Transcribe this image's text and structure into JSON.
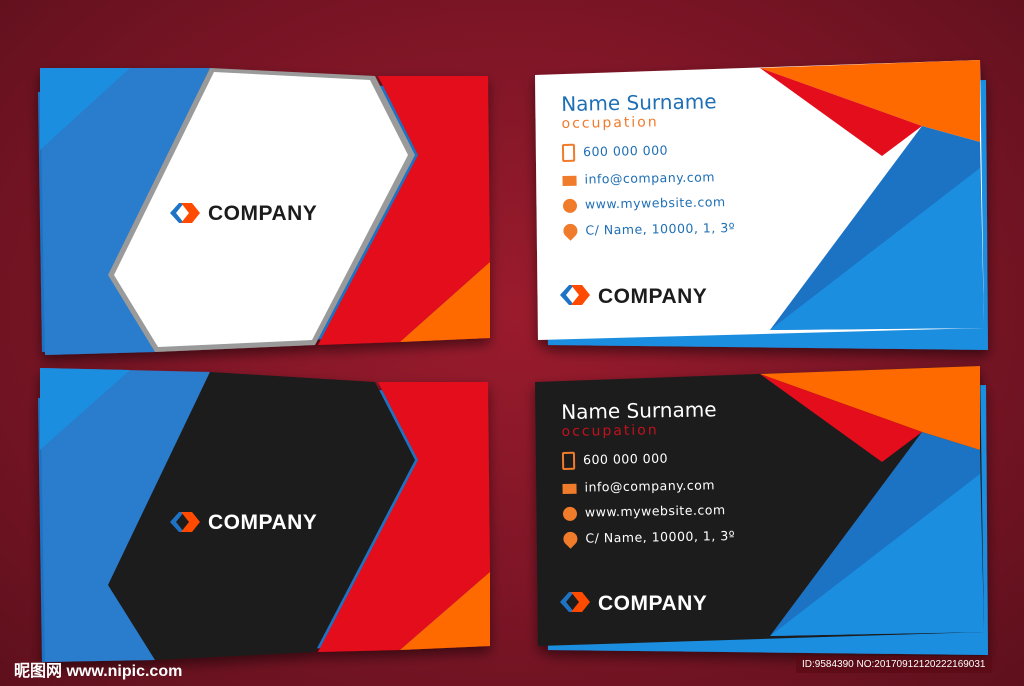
{
  "cards": {
    "front_white": {
      "company": "COMPANY"
    },
    "front_black": {
      "company": "COMPANY"
    },
    "back_white": {
      "name": "Name Surname",
      "occupation": "occupation",
      "phone": "600 000 000",
      "email": "info@company.com",
      "website": "www.mywebsite.com",
      "address": "C/ Name, 10000, 1, 3º",
      "company": "COMPANY"
    },
    "back_black": {
      "name": "Name Surname",
      "occupation": "occupation",
      "phone": "600 000 000",
      "email": "info@company.com",
      "website": "www.mywebsite.com",
      "address": "C/ Name, 10000, 1, 3º",
      "company": "COMPANY"
    }
  },
  "watermark": {
    "site": "昵图网 www.nipic.com",
    "id": "ID:9584390 NO:20170912120222169031"
  },
  "colors": {
    "blue": "#1f73c4",
    "light_blue": "#1a8ee0",
    "red": "#e30b1c",
    "orange": "#ff6a00",
    "black": "#1c1c1c",
    "background": "#7c1526"
  }
}
